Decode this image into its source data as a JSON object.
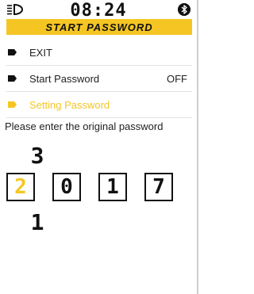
{
  "status": {
    "time": "08:24",
    "headlight_icon": "headlight-icon",
    "bluetooth_icon": "bluetooth-icon"
  },
  "title": "START PASSWORD",
  "menu": {
    "items": [
      {
        "label": "EXIT",
        "value": "",
        "active": false
      },
      {
        "label": "Start Password",
        "value": "OFF",
        "active": false
      },
      {
        "label": "Setting Password",
        "value": "",
        "active": true
      }
    ]
  },
  "prompt": "Please enter the original password",
  "password": {
    "digits": [
      "2",
      "0",
      "1",
      "7"
    ],
    "active_index": 0,
    "above": "3",
    "below": "1"
  },
  "colors": {
    "accent": "#f5c623",
    "text": "#222222"
  }
}
